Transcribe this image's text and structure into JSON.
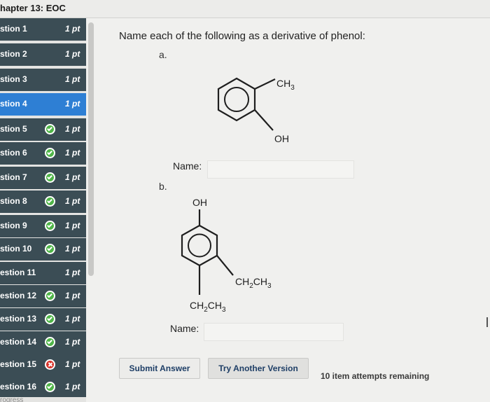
{
  "header": {
    "chapter_title": "hapter 13: EOC"
  },
  "sidebar": {
    "items": [
      {
        "label": "stion 1",
        "points": "1 pt",
        "status": "none"
      },
      {
        "label": "stion 2",
        "points": "1 pt",
        "status": "none"
      },
      {
        "label": "stion 3",
        "points": "1 pt",
        "status": "none"
      },
      {
        "label": "stion 4",
        "points": "1 pt",
        "status": "active"
      },
      {
        "label": "stion 5",
        "points": "1 pt",
        "status": "correct"
      },
      {
        "label": "stion 6",
        "points": "1 pt",
        "status": "correct"
      },
      {
        "label": "stion 7",
        "points": "1 pt",
        "status": "correct"
      },
      {
        "label": "stion 8",
        "points": "1 pt",
        "status": "correct"
      },
      {
        "label": "stion 9",
        "points": "1 pt",
        "status": "correct"
      },
      {
        "label": "stion 10",
        "points": "1 pt",
        "status": "correct"
      },
      {
        "label": "estion 11",
        "points": "1 pt",
        "status": "none"
      },
      {
        "label": "estion 12",
        "points": "1 pt",
        "status": "correct"
      },
      {
        "label": "estion 13",
        "points": "1 pt",
        "status": "correct"
      },
      {
        "label": "estion 14",
        "points": "1 pt",
        "status": "correct"
      },
      {
        "label": "estion 15",
        "points": "1 pt",
        "status": "incorrect"
      },
      {
        "label": "estion 16",
        "points": "1 pt",
        "status": "correct"
      }
    ],
    "footer_partial": "rogress"
  },
  "question": {
    "prompt": "Name each of the following as a derivative of phenol:",
    "part_a": {
      "label": "a.",
      "substituent_top": "CH",
      "substituent_top_sub": "3",
      "substituent_bottom": "OH",
      "name_label": "Name:",
      "name_value": ""
    },
    "part_b": {
      "label": "b.",
      "substituent_top": "OH",
      "substituent_right_1": "CH",
      "substituent_right_sub1": "2",
      "substituent_right_2": "CH",
      "substituent_right_sub2": "3",
      "substituent_bottom_1": "CH",
      "substituent_bottom_sub1": "2",
      "substituent_bottom_2": "CH",
      "substituent_bottom_sub2": "3",
      "name_label": "Name:",
      "name_value": ""
    }
  },
  "actions": {
    "submit_label": "Submit Answer",
    "try_another_label": "Try Another Version",
    "attempts_text": "10 item attempts remaining"
  },
  "colors": {
    "sidebar_item_bg": "#3b4d55",
    "sidebar_active_bg": "#2e7fd4",
    "correct": "#4fb548",
    "incorrect": "#d9342b",
    "button_text": "#1e3e66"
  }
}
